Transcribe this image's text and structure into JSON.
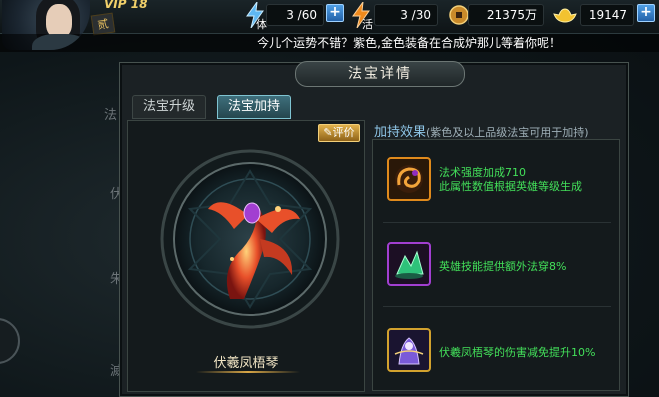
{
  "player": {
    "vip_label": "VIP 18",
    "rank_badge": "贰"
  },
  "stats": {
    "stamina": {
      "tag": "体",
      "value": "3 /60"
    },
    "energy": {
      "tag": "活",
      "value": "3 /30"
    },
    "coins": {
      "value": "21375万"
    },
    "ingots": {
      "value": "19147"
    },
    "plus_label": "+"
  },
  "notice": "今儿个运势不错？紫色,金色装备在合成炉那儿等着你呢！",
  "background": {
    "labels": [
      "法",
      "伏",
      "朱",
      "滅"
    ]
  },
  "panel": {
    "title": "法宝详情",
    "tabs": [
      {
        "label": "法宝升级",
        "active": false
      },
      {
        "label": "法宝加持",
        "active": true
      }
    ],
    "rate_button": "评价",
    "item_name": "伏羲凤梧琴",
    "effects_title": "加持效果",
    "effects_note": "(紫色及以上品级法宝可用于加持)",
    "effects": [
      {
        "lines": [
          "法术强度加成710",
          "此属性数值根据英雄等级生成"
        ],
        "icon": "orange-dragon-icon",
        "frame_color": "#e08a1c"
      },
      {
        "lines": [
          "英雄技能提供额外法穿8%"
        ],
        "icon": "green-crystal-icon",
        "frame_color": "#a23fd1"
      },
      {
        "lines": [
          "伏羲凤梧琴的伤害减免提升10%"
        ],
        "icon": "purple-spirit-icon",
        "frame_color": "#d2a22e"
      }
    ]
  },
  "colors": {
    "effect_text": "#43e05a",
    "title_blue": "#8fc6e8",
    "accent_gold": "#d8a646"
  }
}
